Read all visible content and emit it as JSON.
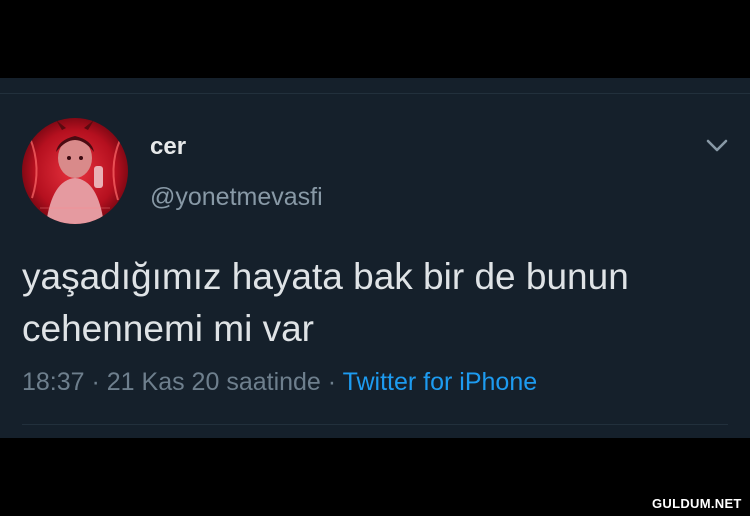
{
  "profile": {
    "display_name": "cer",
    "handle": "@yonetmevasfi",
    "avatar_icon": "profile-photo"
  },
  "tweet": {
    "text": "yaşadığımız hayata bak bir de bunun\ncehennemi mi var",
    "time": "18:37",
    "separator_1": " · ",
    "date": "21 Kas 20 saatinde",
    "separator_2": " · ",
    "source": "Twitter for iPhone"
  },
  "menu": {
    "icon": "chevron-down-icon"
  },
  "watermark": {
    "text": "GULDUM.NET"
  },
  "colors": {
    "page_background": "#000000",
    "panel_background": "#15202b",
    "primary_text": "#dfe3e6",
    "secondary_text": "#8899a6",
    "link_blue": "#1d9bf0",
    "avatar_red": "#c8102e"
  }
}
